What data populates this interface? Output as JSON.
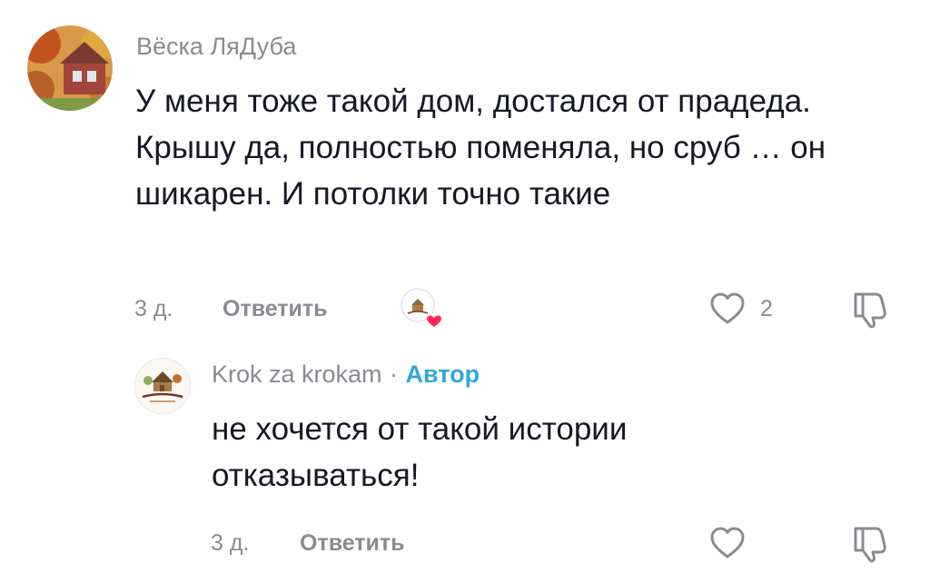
{
  "comment": {
    "username": "Вёска ЛяДуба",
    "text": "У меня тоже такой дом, достался от прадеда. Крышу да, полностью поменяла, но сруб … он шикарен. И потолки точно такие",
    "time": "3 д.",
    "reply_label": "Ответить",
    "like_count": "2"
  },
  "reply": {
    "username": "Krok za krokam",
    "separator": "·",
    "author_badge": "Автор",
    "text": "не хочется от такой истории отказываться!",
    "time": "3 д.",
    "reply_label": "Ответить"
  },
  "icons": {
    "comment_avatar": "autumn-house-avatar",
    "reply_avatar": "nikolskie-logo-avatar",
    "creator_liked": "creator-liked-badge",
    "like": "heart-outline-icon",
    "dislike": "thumbs-down-icon"
  },
  "colors": {
    "author_badge": "#2fa8d8",
    "liked_heart": "#fe2c55",
    "muted_text": "#8a8b91"
  }
}
